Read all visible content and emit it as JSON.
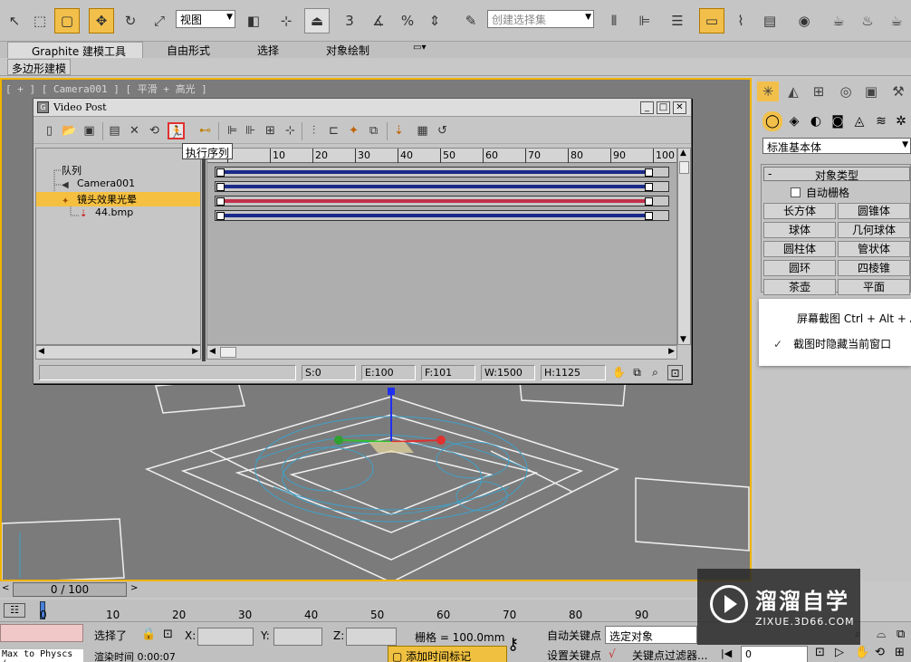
{
  "toolbar": {
    "ref_coord": "视图",
    "selection_set_placeholder": "创建选择集",
    "angle_snap_label": "3"
  },
  "ribbon": {
    "tabs": [
      "Graphite 建模工具",
      "自由形式",
      "选择",
      "对象绘制"
    ],
    "subtab": "多边形建模"
  },
  "viewport": {
    "label": "[ + ] [ Camera001 ] [ 平滑 + 高光 ]"
  },
  "video_post": {
    "title": "Video Post",
    "tooltip": "执行序列",
    "tree": {
      "root": "队列",
      "items": [
        "Camera001",
        "镜头效果光晕",
        "44.bmp"
      ]
    },
    "ruler": [
      "0",
      "10",
      "20",
      "30",
      "40",
      "50",
      "60",
      "70",
      "80",
      "90",
      "100"
    ],
    "track_colors": [
      "#1a2a8a",
      "#1a2a8a",
      "#c0304a",
      "#1a2a8a"
    ],
    "status": {
      "s": "S:0",
      "e": "E:100",
      "f": "F:101",
      "w": "W:1500",
      "h": "H:1125"
    }
  },
  "command_panel": {
    "category": "标准基本体",
    "rollout_title": "对象类型",
    "autogrid": "自动栅格",
    "objects": [
      "长方体",
      "圆锥体",
      "球体",
      "几何球体",
      "圆柱体",
      "管状体",
      "圆环",
      "四棱锥",
      "茶壶",
      "平面"
    ]
  },
  "context_menu": {
    "items": [
      "屏幕截图 Ctrl + Alt + A",
      "截图时隐藏当前窗口"
    ]
  },
  "timeline": {
    "frame_display": "0 / 100",
    "ticks": [
      "0",
      "10",
      "20",
      "30",
      "40",
      "50",
      "60",
      "70",
      "80",
      "90"
    ]
  },
  "statusbar": {
    "script_label": "Max to Physcs (",
    "selected": "选择了",
    "x_label": "X:",
    "y_label": "Y:",
    "z_label": "Z:",
    "grid": "栅格 = 100.0mm",
    "auto_key": "自动关键点",
    "selected_obj": "选定对象",
    "set_key": "设置关键点",
    "key_filter": "关键点过滤器...",
    "render_time": "渲染时间",
    "render_time_value": "0:00:07",
    "add_time_tag": "添加时间标记",
    "frame": "0"
  },
  "watermark": {
    "title": "溜溜自学",
    "subtitle": "ZIXUE.3D66.COM"
  }
}
